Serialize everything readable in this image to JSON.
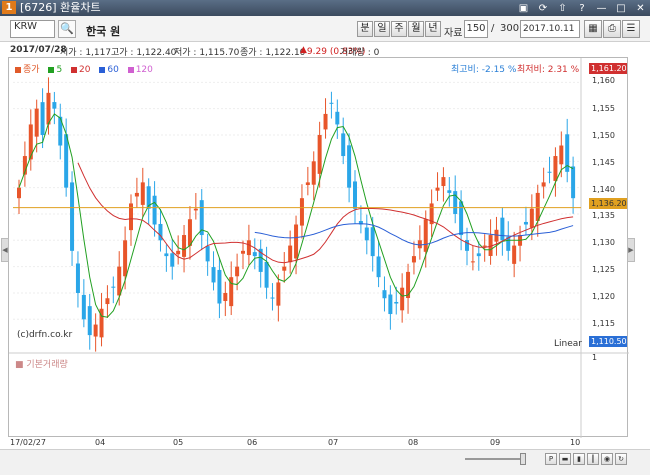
{
  "window": {
    "code": "6726",
    "title": "환율차트",
    "icon_label": "1"
  },
  "toolbar": {
    "symbol_code": "KRW",
    "symbol_name": "한국 원",
    "period_buttons": [
      "분",
      "일",
      "주",
      "월",
      "년"
    ],
    "data_label": "자료",
    "data_count": "150",
    "data_total": "300",
    "end_date": "2017.10.11"
  },
  "info": {
    "date": "2017/07/28",
    "open_label": "시가 : 1,117",
    "high_label": "고가 : 1,122.40",
    "low_label": "저가 : 1,115.70",
    "close_label": "종가 : 1,122.10",
    "change": "9.29 (0.83%)",
    "volume_label": "거래량 : 0"
  },
  "legend": [
    {
      "label": "종가",
      "color": "#e05a2a"
    },
    {
      "label": "5",
      "color": "#22a022"
    },
    {
      "label": "20",
      "color": "#d03030"
    },
    {
      "label": "60",
      "color": "#2a5fd6"
    },
    {
      "label": "120",
      "color": "#d060d0"
    }
  ],
  "ratios": {
    "high_ratio": "최고비: -2.15 %",
    "low_ratio": "최저비: 2.31 %"
  },
  "watermark": "(c)drfn.co.kr",
  "scale_mode": "Linear",
  "volume_title": "기본거래량",
  "colors": {
    "up": "#e8552a",
    "down": "#2aa6e8",
    "ma5": "#22a022",
    "ma20": "#d03030",
    "ma60": "#2a5fd6",
    "high_box": "#d03030",
    "last_box": "#e0a020",
    "low_box": "#2a6fd6",
    "last_line": "#e0a020"
  },
  "yaxis": {
    "ticks": [
      "1,160",
      "1,155",
      "1,150",
      "1,145",
      "1,140",
      "1,135",
      "1,130",
      "1,125",
      "1,120",
      "1,115"
    ],
    "high_label": "1,161.20",
    "last_label": "1,136.20",
    "low_label": "1,110.50",
    "vol_tick": "1"
  },
  "xaxis": {
    "labels": [
      "17/02/27",
      "04",
      "05",
      "06",
      "07",
      "08",
      "09",
      "10"
    ]
  },
  "chart_data": {
    "type": "candlestick",
    "yrange": [
      1110.5,
      1161.2
    ],
    "last": 1136.2,
    "closes": [
      1140,
      1146,
      1152,
      1155,
      1150,
      1158,
      1155,
      1148,
      1140,
      1128,
      1120,
      1115,
      1112,
      1114,
      1117,
      1119,
      1121,
      1125,
      1130,
      1137,
      1139,
      1141,
      1136,
      1133,
      1130,
      1127,
      1125,
      1128,
      1131,
      1134,
      1136,
      1131,
      1126,
      1122,
      1118,
      1120,
      1123,
      1125,
      1128,
      1130,
      1127,
      1124,
      1121,
      1119,
      1122,
      1125,
      1129,
      1133,
      1138,
      1141,
      1145,
      1150,
      1154,
      1156,
      1152,
      1146,
      1140,
      1136,
      1133,
      1130,
      1127,
      1123,
      1119,
      1116,
      1118,
      1121,
      1124,
      1127,
      1130,
      1134,
      1137,
      1140,
      1142,
      1139,
      1135,
      1131,
      1128,
      1126,
      1127,
      1129,
      1131,
      1132,
      1130,
      1128,
      1129,
      1131,
      1133,
      1136,
      1139,
      1141,
      1143,
      1146,
      1148,
      1143,
      1138
    ]
  }
}
